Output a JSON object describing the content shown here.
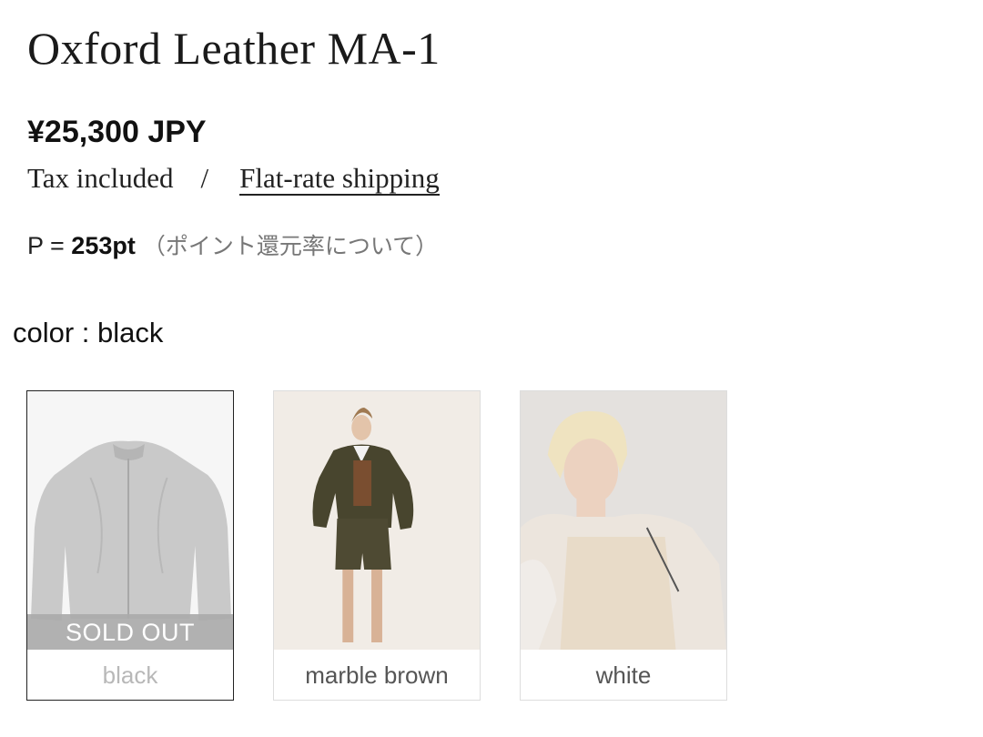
{
  "product": {
    "title": "Oxford Leather MA-1",
    "price": "¥25,300 JPY",
    "tax_text": "Tax included",
    "separator": "/",
    "shipping_link": "Flat-rate shipping",
    "points_prefix": "P = ",
    "points_value": "253pt",
    "points_about": "（ポイント還元率について）"
  },
  "variants": {
    "label": "color : black",
    "options": [
      {
        "name": "black",
        "status": "SOLD OUT",
        "selected": true
      },
      {
        "name": "marble brown",
        "selected": false
      },
      {
        "name": "white",
        "selected": false
      }
    ]
  },
  "colors": {
    "text": "#111111",
    "muted": "#777777",
    "soldout_band": "#aaaaaa",
    "swatch_border": "#dddddd",
    "selected_border": "#222222"
  }
}
